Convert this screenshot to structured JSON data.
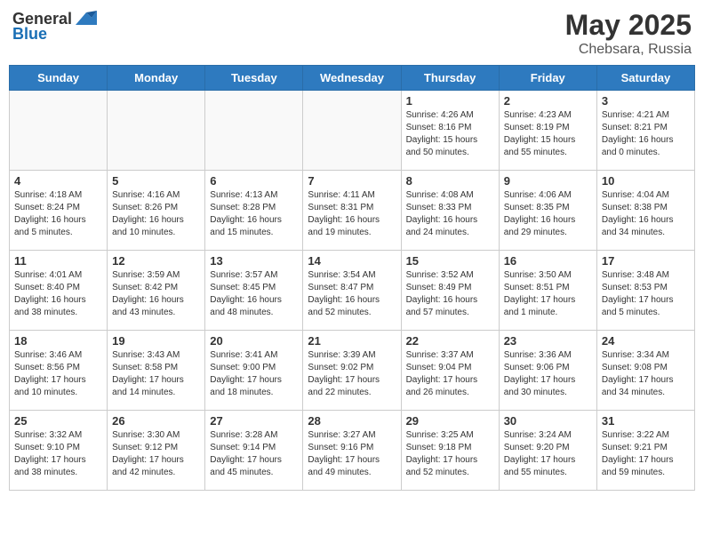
{
  "header": {
    "logo_general": "General",
    "logo_blue": "Blue",
    "title": "May 2025",
    "location": "Chebsara, Russia"
  },
  "weekdays": [
    "Sunday",
    "Monday",
    "Tuesday",
    "Wednesday",
    "Thursday",
    "Friday",
    "Saturday"
  ],
  "weeks": [
    [
      {
        "day": "",
        "info": ""
      },
      {
        "day": "",
        "info": ""
      },
      {
        "day": "",
        "info": ""
      },
      {
        "day": "",
        "info": ""
      },
      {
        "day": "1",
        "info": "Sunrise: 4:26 AM\nSunset: 8:16 PM\nDaylight: 15 hours\nand 50 minutes."
      },
      {
        "day": "2",
        "info": "Sunrise: 4:23 AM\nSunset: 8:19 PM\nDaylight: 15 hours\nand 55 minutes."
      },
      {
        "day": "3",
        "info": "Sunrise: 4:21 AM\nSunset: 8:21 PM\nDaylight: 16 hours\nand 0 minutes."
      }
    ],
    [
      {
        "day": "4",
        "info": "Sunrise: 4:18 AM\nSunset: 8:24 PM\nDaylight: 16 hours\nand 5 minutes."
      },
      {
        "day": "5",
        "info": "Sunrise: 4:16 AM\nSunset: 8:26 PM\nDaylight: 16 hours\nand 10 minutes."
      },
      {
        "day": "6",
        "info": "Sunrise: 4:13 AM\nSunset: 8:28 PM\nDaylight: 16 hours\nand 15 minutes."
      },
      {
        "day": "7",
        "info": "Sunrise: 4:11 AM\nSunset: 8:31 PM\nDaylight: 16 hours\nand 19 minutes."
      },
      {
        "day": "8",
        "info": "Sunrise: 4:08 AM\nSunset: 8:33 PM\nDaylight: 16 hours\nand 24 minutes."
      },
      {
        "day": "9",
        "info": "Sunrise: 4:06 AM\nSunset: 8:35 PM\nDaylight: 16 hours\nand 29 minutes."
      },
      {
        "day": "10",
        "info": "Sunrise: 4:04 AM\nSunset: 8:38 PM\nDaylight: 16 hours\nand 34 minutes."
      }
    ],
    [
      {
        "day": "11",
        "info": "Sunrise: 4:01 AM\nSunset: 8:40 PM\nDaylight: 16 hours\nand 38 minutes."
      },
      {
        "day": "12",
        "info": "Sunrise: 3:59 AM\nSunset: 8:42 PM\nDaylight: 16 hours\nand 43 minutes."
      },
      {
        "day": "13",
        "info": "Sunrise: 3:57 AM\nSunset: 8:45 PM\nDaylight: 16 hours\nand 48 minutes."
      },
      {
        "day": "14",
        "info": "Sunrise: 3:54 AM\nSunset: 8:47 PM\nDaylight: 16 hours\nand 52 minutes."
      },
      {
        "day": "15",
        "info": "Sunrise: 3:52 AM\nSunset: 8:49 PM\nDaylight: 16 hours\nand 57 minutes."
      },
      {
        "day": "16",
        "info": "Sunrise: 3:50 AM\nSunset: 8:51 PM\nDaylight: 17 hours\nand 1 minute."
      },
      {
        "day": "17",
        "info": "Sunrise: 3:48 AM\nSunset: 8:53 PM\nDaylight: 17 hours\nand 5 minutes."
      }
    ],
    [
      {
        "day": "18",
        "info": "Sunrise: 3:46 AM\nSunset: 8:56 PM\nDaylight: 17 hours\nand 10 minutes."
      },
      {
        "day": "19",
        "info": "Sunrise: 3:43 AM\nSunset: 8:58 PM\nDaylight: 17 hours\nand 14 minutes."
      },
      {
        "day": "20",
        "info": "Sunrise: 3:41 AM\nSunset: 9:00 PM\nDaylight: 17 hours\nand 18 minutes."
      },
      {
        "day": "21",
        "info": "Sunrise: 3:39 AM\nSunset: 9:02 PM\nDaylight: 17 hours\nand 22 minutes."
      },
      {
        "day": "22",
        "info": "Sunrise: 3:37 AM\nSunset: 9:04 PM\nDaylight: 17 hours\nand 26 minutes."
      },
      {
        "day": "23",
        "info": "Sunrise: 3:36 AM\nSunset: 9:06 PM\nDaylight: 17 hours\nand 30 minutes."
      },
      {
        "day": "24",
        "info": "Sunrise: 3:34 AM\nSunset: 9:08 PM\nDaylight: 17 hours\nand 34 minutes."
      }
    ],
    [
      {
        "day": "25",
        "info": "Sunrise: 3:32 AM\nSunset: 9:10 PM\nDaylight: 17 hours\nand 38 minutes."
      },
      {
        "day": "26",
        "info": "Sunrise: 3:30 AM\nSunset: 9:12 PM\nDaylight: 17 hours\nand 42 minutes."
      },
      {
        "day": "27",
        "info": "Sunrise: 3:28 AM\nSunset: 9:14 PM\nDaylight: 17 hours\nand 45 minutes."
      },
      {
        "day": "28",
        "info": "Sunrise: 3:27 AM\nSunset: 9:16 PM\nDaylight: 17 hours\nand 49 minutes."
      },
      {
        "day": "29",
        "info": "Sunrise: 3:25 AM\nSunset: 9:18 PM\nDaylight: 17 hours\nand 52 minutes."
      },
      {
        "day": "30",
        "info": "Sunrise: 3:24 AM\nSunset: 9:20 PM\nDaylight: 17 hours\nand 55 minutes."
      },
      {
        "day": "31",
        "info": "Sunrise: 3:22 AM\nSunset: 9:21 PM\nDaylight: 17 hours\nand 59 minutes."
      }
    ]
  ]
}
